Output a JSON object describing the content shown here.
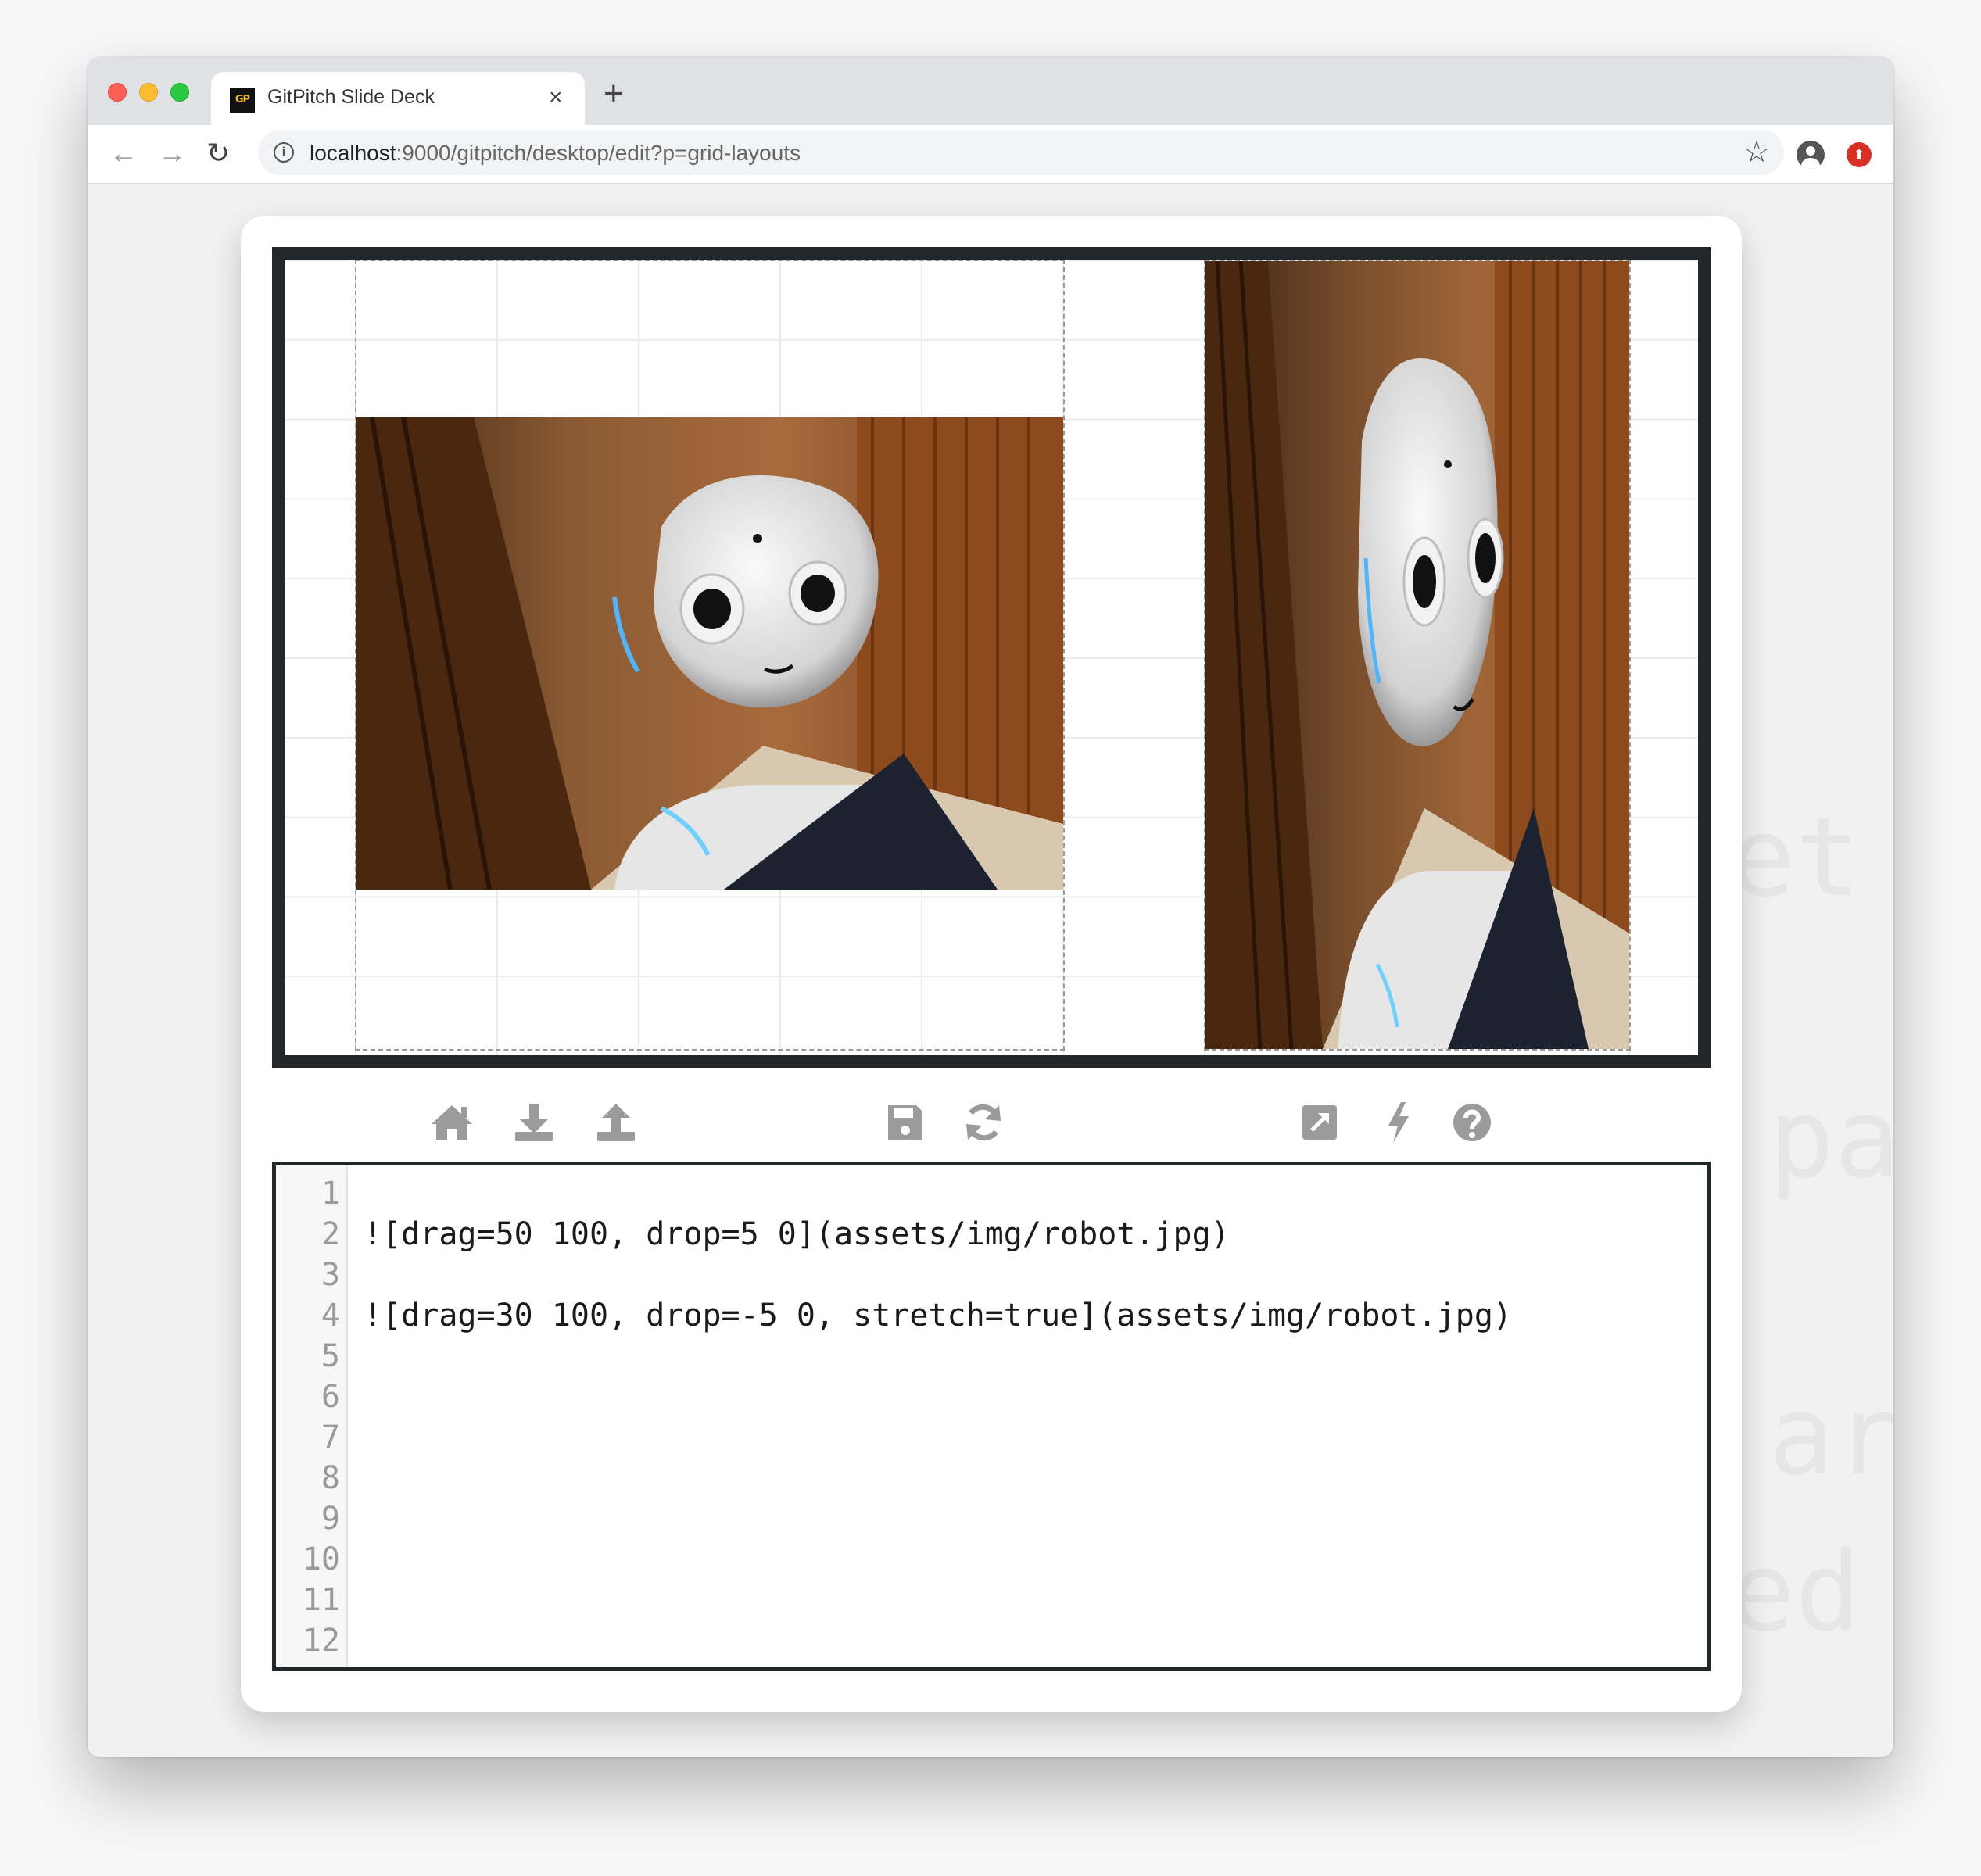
{
  "browser": {
    "tab_title": "GitPitch Slide Deck",
    "favicon_text": "GP",
    "tab_close": "×",
    "new_tab": "+",
    "url_host": "localhost",
    "url_path": ":9000/gitpitch/desktop/edit?p=grid-layouts",
    "nav": {
      "back": "←",
      "forward": "→",
      "reload": "↻"
    },
    "bookmark_star": "☆",
    "info_glyph": "i",
    "extension_glyph": "⬆"
  },
  "background_ghost_text": [
    "et",
    "pa",
    "ar",
    "ed ("
  ],
  "slide": {
    "images": [
      {
        "name": "robot-image-left",
        "src": "assets/img/robot.jpg",
        "drag": "50 100",
        "drop": "5 0",
        "stretch": false
      },
      {
        "name": "robot-image-right",
        "src": "assets/img/robot.jpg",
        "drag": "30 100",
        "drop": "-5 0",
        "stretch": true
      }
    ]
  },
  "actions": {
    "left": [
      "home-icon",
      "download-icon",
      "upload-icon"
    ],
    "center": [
      "save-icon",
      "refresh-icon"
    ],
    "right": [
      "external-link-icon",
      "bolt-icon",
      "help-icon"
    ]
  },
  "editor": {
    "line_numbers": [
      "1",
      "2",
      "3",
      "4",
      "5",
      "6",
      "7",
      "8",
      "9",
      "10",
      "11",
      "12"
    ],
    "lines": [
      "",
      "![drag=50 100, drop=5 0](assets/img/robot.jpg)",
      "",
      "![drag=30 100, drop=-5 0, stretch=true](assets/img/robot.jpg)",
      "",
      "",
      "",
      "",
      "",
      "",
      "",
      ""
    ]
  },
  "colors": {
    "slide_border": "#22282a",
    "icon_gray": "#9b9b9b",
    "traffic_red": "#ff5f57",
    "traffic_yellow": "#febc2e",
    "traffic_green": "#28c840"
  }
}
